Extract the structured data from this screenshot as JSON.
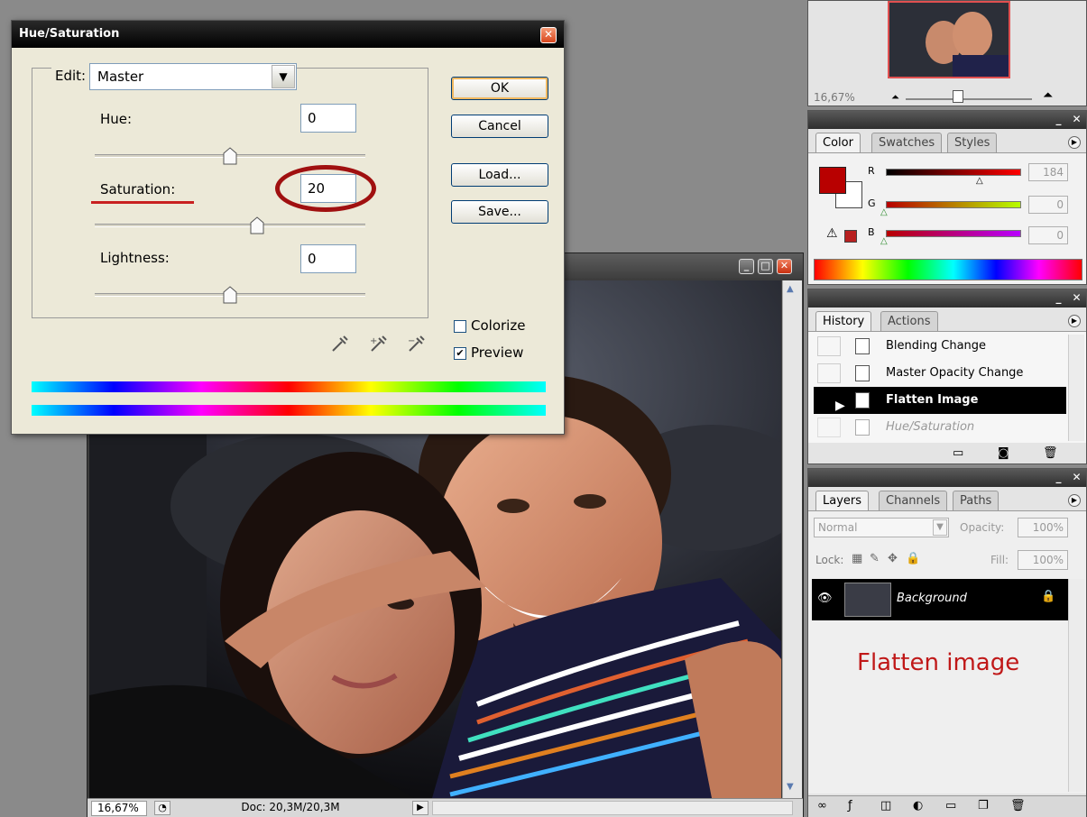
{
  "dialog": {
    "title": "Hue/Saturation",
    "close_glyph": "✕",
    "edit_label": "Edit:",
    "edit_value": "Master",
    "hue_label": "Hue:",
    "hue_value": "0",
    "saturation_label": "Saturation:",
    "saturation_value": "20",
    "lightness_label": "Lightness:",
    "lightness_value": "0",
    "hue_level": 0.5,
    "saturation_level": 0.6,
    "lightness_level": 0.5,
    "ok_label": "OK",
    "cancel_label": "Cancel",
    "load_label": "Load...",
    "save_label": "Save...",
    "colorize_label": "Colorize",
    "colorize_checked": false,
    "preview_label": "Preview",
    "preview_checked": true,
    "annotation_color": "#b01818"
  },
  "navigator": {
    "zoom": "16,67%"
  },
  "color_panel": {
    "tabs": [
      "Color",
      "Swatches",
      "Styles"
    ],
    "r_label": "R",
    "r_value": "184",
    "g_label": "G",
    "g_value": "0",
    "b_label": "B",
    "b_value": "0",
    "foreground_color": "#b80000"
  },
  "history_panel": {
    "tabs": [
      "History",
      "Actions"
    ],
    "items": [
      "Blending Change",
      "Master Opacity Change",
      "Flatten Image",
      "Hue/Saturation"
    ],
    "selected_item": "Flatten Image"
  },
  "layers_panel": {
    "tabs": [
      "Layers",
      "Channels",
      "Paths"
    ],
    "blend_mode": "Normal",
    "opacity_label": "Opacity:",
    "opacity_value": "100%",
    "lock_label": "Lock:",
    "fill_label": "Fill:",
    "fill_value": "100%",
    "layer_name": "Background"
  },
  "annotation": {
    "note": "Flatten image"
  },
  "document": {
    "zoom": "16,67%",
    "doc_size": "Doc: 20,3M/20,3M"
  }
}
